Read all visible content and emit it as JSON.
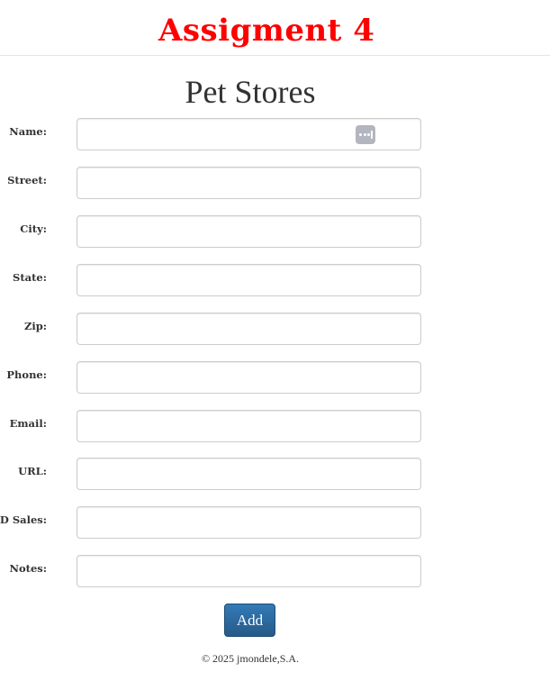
{
  "header": {
    "app_title": "Assigment 4"
  },
  "page_title": "Pet Stores",
  "form": {
    "fields": [
      {
        "label": "Name:",
        "value": "",
        "has_autofill_icon": true
      },
      {
        "label": "Street:",
        "value": ""
      },
      {
        "label": "City:",
        "value": ""
      },
      {
        "label": "State:",
        "value": ""
      },
      {
        "label": "Zip:",
        "value": ""
      },
      {
        "label": "Phone:",
        "value": ""
      },
      {
        "label": "Email:",
        "value": ""
      },
      {
        "label": "URL:",
        "value": ""
      },
      {
        "label": "YTD Sales:",
        "value": ""
      },
      {
        "label": "Notes:",
        "value": ""
      }
    ],
    "submit_label": "Add"
  },
  "footer": {
    "text": "© 2025 jmondele,S.A."
  },
  "colors": {
    "title": "#ff0000",
    "button": "#337ab7",
    "autofill_icon": "#b3b6bf"
  },
  "icons": {
    "autofill": "password-manager-dots-icon"
  }
}
